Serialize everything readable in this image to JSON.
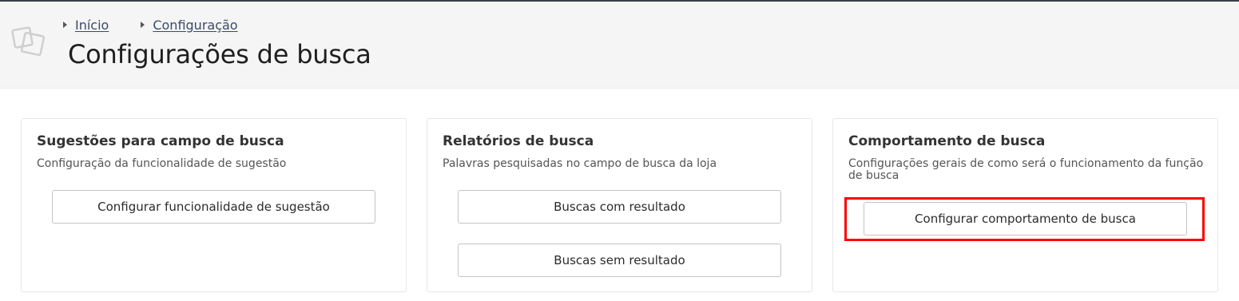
{
  "breadcrumb": {
    "items": [
      {
        "label": "Início"
      },
      {
        "label": "Configuração"
      }
    ]
  },
  "page": {
    "title": "Configurações de busca"
  },
  "cards": [
    {
      "title": "Sugestões para campo de busca",
      "description": "Configuração da funcionalidade de sugestão",
      "buttons": [
        {
          "label": "Configurar funcionalidade de sugestão"
        }
      ]
    },
    {
      "title": "Relatórios de busca",
      "description": "Palavras pesquisadas no campo de busca da loja",
      "buttons": [
        {
          "label": "Buscas com resultado"
        },
        {
          "label": "Buscas sem resultado"
        }
      ]
    },
    {
      "title": "Comportamento de busca",
      "description": "Configurações gerais de como será o funcionamento da função de busca",
      "buttons": [
        {
          "label": "Configurar comportamento de busca"
        }
      ]
    }
  ],
  "colors": {
    "highlight": "#ff0000",
    "header_bg": "#f5f5f5",
    "link": "#3a4a6b"
  }
}
